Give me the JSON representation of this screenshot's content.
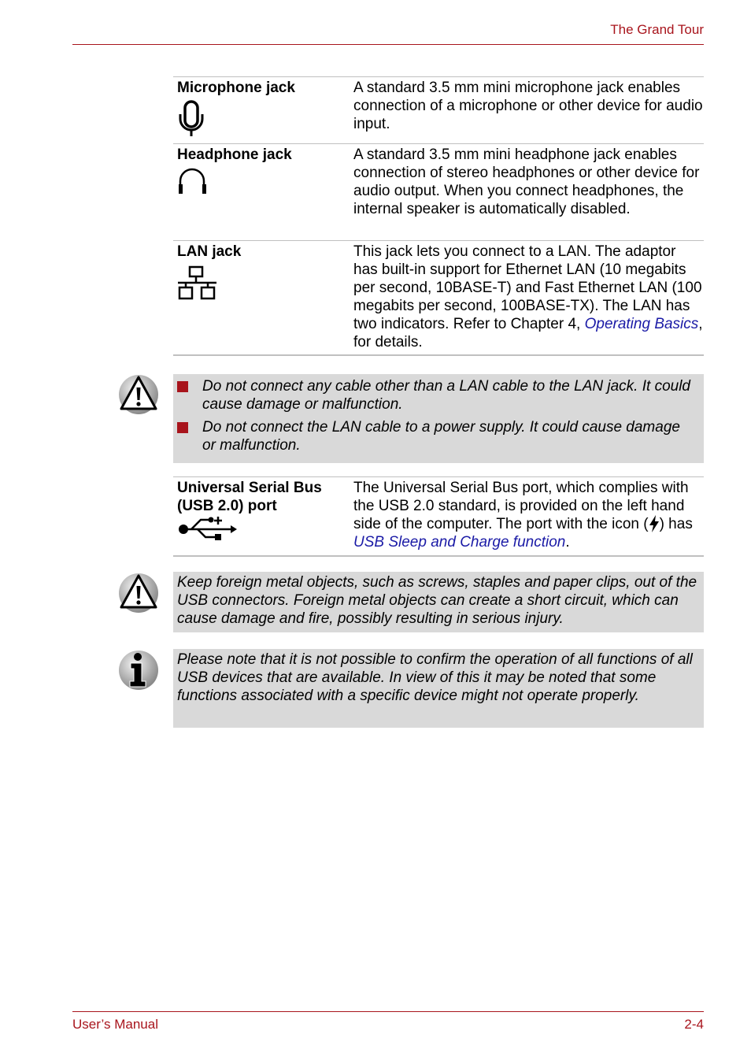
{
  "header": {
    "title": "The Grand Tour"
  },
  "footer": {
    "left": "User’s Manual",
    "right": "2-4"
  },
  "table1": {
    "rows": [
      {
        "name": "Microphone jack",
        "icon": "microphone-icon",
        "desc": "A standard 3.5 mm mini microphone jack enables connection of a microphone or other device for audio input."
      },
      {
        "name": "Headphone jack",
        "icon": "headphone-icon",
        "desc": "A standard 3.5 mm mini headphone jack enables connection of stereo headphones or other device for audio output. When you connect headphones, the internal speaker is automatically disabled."
      },
      {
        "name": "LAN jack",
        "icon": "lan-icon",
        "desc_pre": "This jack lets you connect to a LAN. The adaptor has built-in support for Ethernet LAN (10 megabits per second, 10BASE-T) and Fast Ethernet LAN (100 megabits per second, 100BASE-TX). The LAN has two indicators. Refer to Chapter 4, ",
        "desc_link": "Operating Basics",
        "desc_post": ", for details."
      }
    ]
  },
  "caution1": {
    "icon": "warning-icon",
    "bullets": [
      "Do not connect any cable other than a LAN cable to the LAN jack. It could cause damage or malfunction.",
      "Do not connect the LAN cable to a power supply. It could cause damage or malfunction."
    ]
  },
  "table2": {
    "rows": [
      {
        "name_line1": "Universal Serial Bus",
        "name_line2": "(USB 2.0) port",
        "icon": "usb-icon",
        "desc_pre": "The Universal Serial Bus port, which complies with the USB 2.0 standard, is provided on the left hand side of the computer. The port with the icon (",
        "desc_mid": ") has ",
        "desc_link": "USB Sleep and Charge function",
        "desc_post": "."
      }
    ]
  },
  "caution2": {
    "icon": "warning-icon",
    "text": "Keep foreign metal objects, such as screws, staples and paper clips, out of the USB connectors. Foreign metal objects can create a short circuit, which can cause damage and fire, possibly resulting in serious injury."
  },
  "note": {
    "icon": "info-icon",
    "text": "Please note that it is not possible to confirm the operation of all functions of all USB devices that are available. In view of this it may be noted that some functions associated with a specific device might not operate properly."
  }
}
